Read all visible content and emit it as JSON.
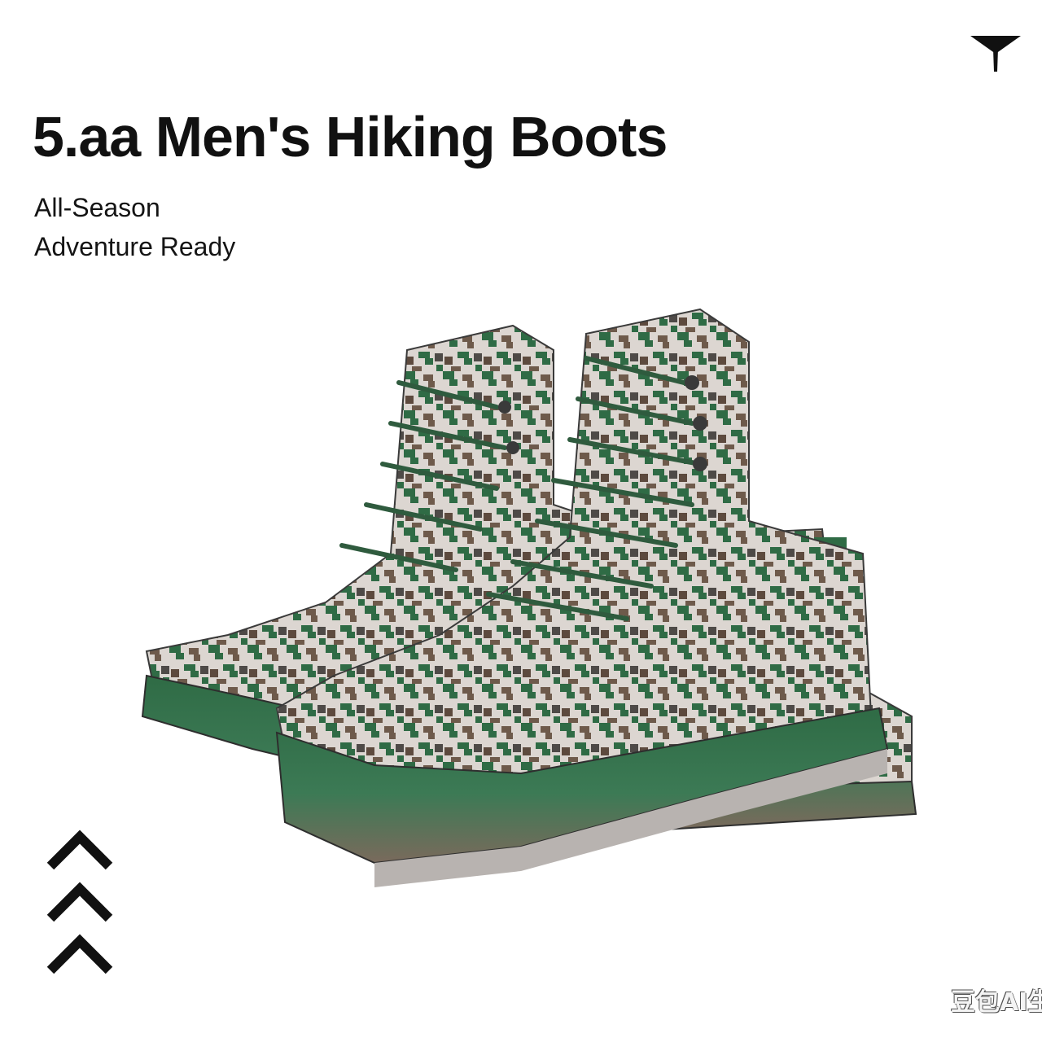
{
  "heading": {
    "title": "5.aa Men's Hiking Boots",
    "subtitle_line1": "All-Season",
    "subtitle_line2": "Adventure Ready"
  },
  "icons": {
    "corner": "down-triangle-icon",
    "chevrons": "triple-chevron-up-icon"
  },
  "product_image": {
    "subject": "digital camouflage high-top hiking boots pair"
  },
  "colors": {
    "text": "#111111",
    "camo_green": "#2f6b45",
    "camo_brown": "#6e5a4b",
    "camo_light": "#d9d4cf",
    "sole_grey": "#b8b3b0"
  },
  "watermark": {
    "text": "豆包AI生成"
  }
}
